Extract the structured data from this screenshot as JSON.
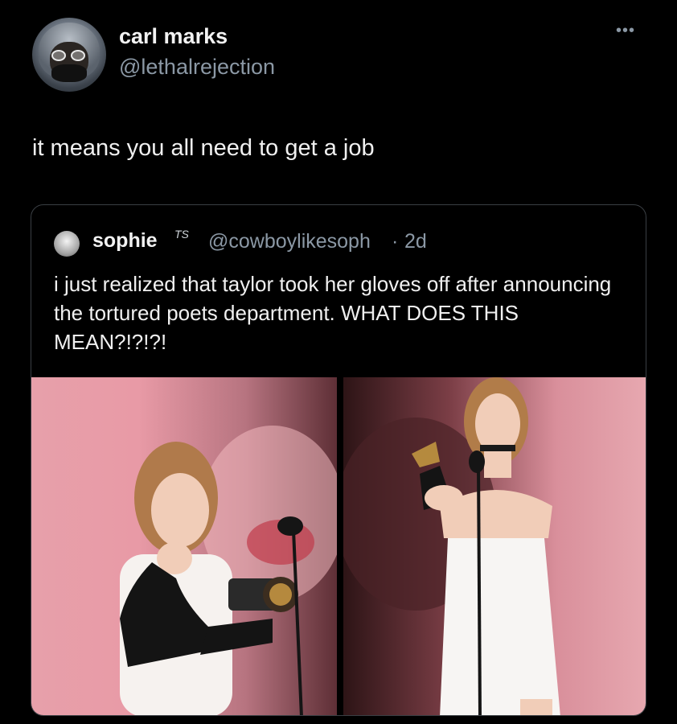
{
  "post": {
    "display_name": "carl marks",
    "handle": "@lethalrejection",
    "more_label": "•••",
    "text": "it means you all need to get a job"
  },
  "quote": {
    "display_name": "sophie",
    "badge": "TS",
    "handle": "@cowboylikesoph",
    "separator": "·",
    "time": "2d",
    "text": "i just realized that taylor took her gloves off after announcing the tortured poets department. WHAT DOES THIS MEAN?!?!?!"
  },
  "icons": {
    "more": "more-options-icon",
    "avatar": "user-avatar",
    "quote_avatar": "quoted-user-avatar"
  },
  "colors": {
    "background": "#000000",
    "primary_text": "#f0f0f0",
    "secondary_text": "#8b98a5",
    "card_border": "#3a3f44"
  }
}
